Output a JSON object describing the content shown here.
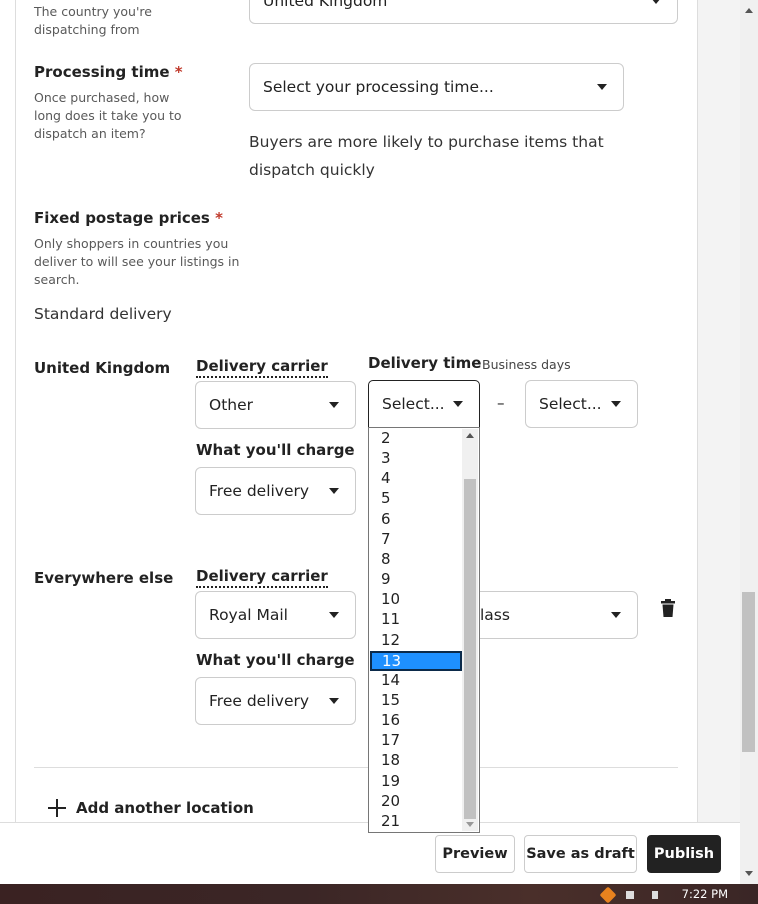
{
  "top_partial": {
    "hint": "The country you're dispatching from",
    "select_value": "United Kingdom"
  },
  "processing": {
    "label": "Processing time",
    "required": "*",
    "hint": "Once purchased, how long does it take you to dispatch an item?",
    "select_placeholder": "Select your processing time...",
    "note": "Buyers are more likely to purchase items that dispatch quickly"
  },
  "postage": {
    "label": "Fixed postage prices",
    "required": "*",
    "hint": "Only shoppers in countries you deliver to will see your listings in search.",
    "subheading": "Standard delivery"
  },
  "uk": {
    "location": "United Kingdom",
    "carrier_label": "Delivery carrier",
    "carrier_value": "Other",
    "time_label": "Delivery time",
    "time_sub": "Business days",
    "time_from": "Select...",
    "dash": "–",
    "time_to": "Select...",
    "charge_label": "What you'll charge",
    "charge_value": "Free delivery"
  },
  "else": {
    "location": "Everywhere else",
    "carrier_label": "Delivery carrier",
    "carrier_value": "Royal Mail",
    "service_value_partial": "lass",
    "charge_label": "What you'll charge",
    "charge_value": "Free delivery"
  },
  "add_location": {
    "icon": "plus-icon",
    "label": "Add another location"
  },
  "dropdown": {
    "options": [
      "2",
      "3",
      "4",
      "5",
      "6",
      "7",
      "8",
      "9",
      "10",
      "11",
      "12",
      "13",
      "14",
      "15",
      "16",
      "17",
      "18",
      "19",
      "20",
      "21"
    ],
    "selected": "13"
  },
  "footer": {
    "preview": "Preview",
    "save_draft": "Save as draft",
    "publish": "Publish"
  },
  "taskbar": {
    "clock": "7:22 PM"
  },
  "icons": {
    "trash": "trash-icon",
    "caret": "caret-down-icon"
  }
}
